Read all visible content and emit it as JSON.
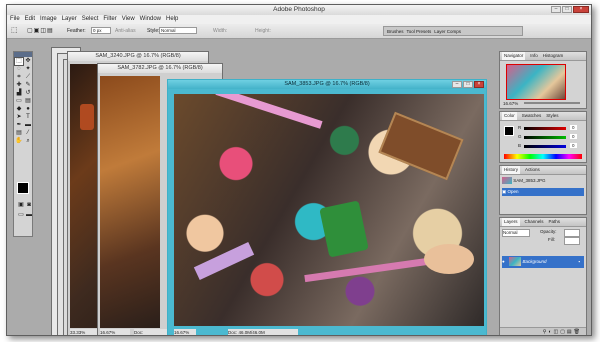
{
  "app": {
    "title": "Adobe Photoshop",
    "window_buttons": [
      "–",
      "□",
      "×"
    ]
  },
  "menu": [
    "File",
    "Edit",
    "Image",
    "Layer",
    "Select",
    "Filter",
    "View",
    "Window",
    "Help"
  ],
  "options": {
    "feather_label": "Feather:",
    "feather_value": "0 px",
    "antialias_label": "Anti-alias",
    "style_label": "Style:",
    "style_value": "Normal",
    "width_label": "Width:",
    "height_label": "Height:",
    "palette_tabs": [
      "Brushes",
      "Tool Presets",
      "Layer Comps"
    ]
  },
  "documents": [
    {
      "title": "SAM_3240.JPG @ 16.7% (RGB/8)",
      "zoom": "33.33%",
      "doc": ""
    },
    {
      "title": "SAM_3782.JPG @ 16.7% (RGB/8)",
      "zoom": "16.67%",
      "doc": "Doc:"
    },
    {
      "title": "SAM_3853.JPG @ 16.7% (RGB/8)",
      "zoom": "16.67%",
      "doc": "Doc: 46.0M/46.0M"
    }
  ],
  "navigator": {
    "tabs": [
      "Navigator",
      "Info",
      "Histogram"
    ],
    "zoom": "16.67%"
  },
  "color": {
    "tabs": [
      "Color",
      "Swatches",
      "Styles"
    ],
    "channels": [
      "R",
      "G",
      "B"
    ],
    "values": [
      "0",
      "0",
      "0"
    ]
  },
  "history": {
    "tabs": [
      "History",
      "Actions"
    ],
    "items": [
      "SAM_3853.JPG",
      "Open"
    ]
  },
  "layers": {
    "tabs": [
      "Layers",
      "Channels",
      "Paths"
    ],
    "blend_mode": "Normal",
    "opacity_label": "Opacity:",
    "fill_label": "Fill:",
    "layer_name": "Background"
  },
  "colors": {
    "active_doc": "#4bb9d0",
    "selection": "#3571c9"
  }
}
